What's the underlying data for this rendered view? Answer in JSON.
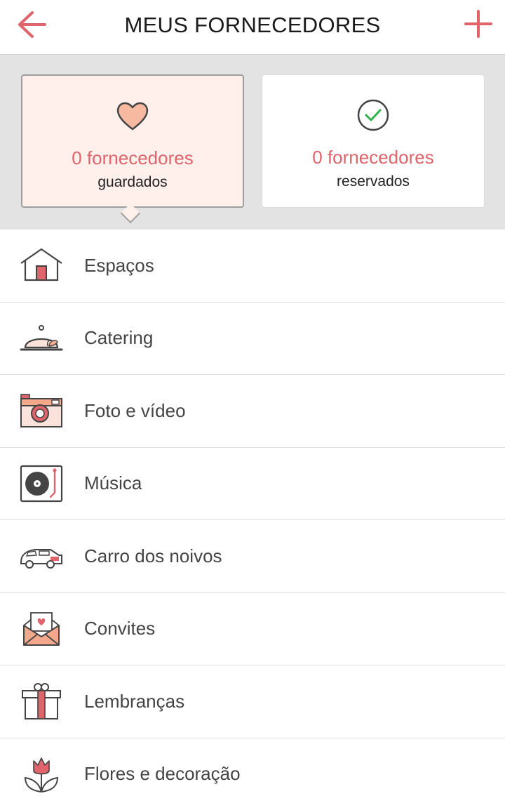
{
  "header": {
    "title": "MEUS FORNECEDORES",
    "back_icon": "arrow-left-icon",
    "add_icon": "plus-icon"
  },
  "summary": {
    "saved": {
      "icon": "heart-icon",
      "count": "0 fornecedores",
      "label": "guardados"
    },
    "booked": {
      "icon": "check-circle-icon",
      "count": "0 fornecedores",
      "label": "reservados"
    }
  },
  "categories": [
    {
      "label": "Espaços",
      "icon": "house-icon"
    },
    {
      "label": "Catering",
      "icon": "food-cloche-icon"
    },
    {
      "label": "Foto e vídeo",
      "icon": "camera-icon"
    },
    {
      "label": "Música",
      "icon": "record-player-icon"
    },
    {
      "label": "Carro dos noivos",
      "icon": "car-icon"
    },
    {
      "label": "Convites",
      "icon": "envelope-heart-icon"
    },
    {
      "label": "Lembranças",
      "icon": "gift-icon"
    },
    {
      "label": "Flores e decoração",
      "icon": "tulip-icon"
    }
  ],
  "colors": {
    "accent": "#e0646b",
    "saved_card_bg": "#fff0ec",
    "summary_bg": "#e3e3e3",
    "check_green": "#2fb34a"
  }
}
